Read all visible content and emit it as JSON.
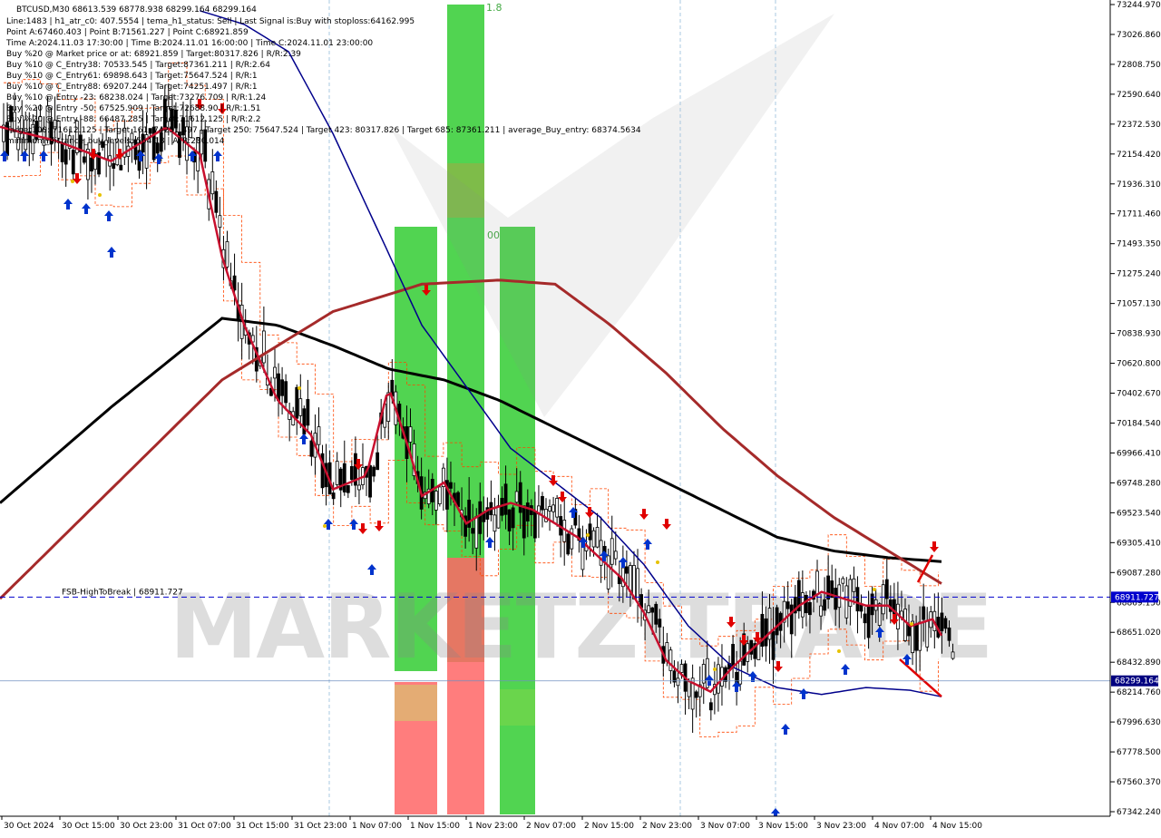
{
  "chart_data": {
    "type": "candlestick",
    "symbol_line": "BTCUSD,M30  68613.539 68778.938 68299.164 68299.164",
    "info_lines": [
      "Line:1483  |  h1_atr_c0: 407.5554  |  tema_h1_status: Sell  |  Last Signal is:Buy with stoploss:64162.995",
      "Point A:67460.403  |  Point B:71561.227  |  Point C:68921.859",
      "Time A:2024.11.03 17:30:00  |  Time B:2024.11.01 16:00:00  |  Time C:2024.11.01 23:00:00",
      "Buy %20 @ Market price or at: 68921.859  |  Target:80317.826  |  R/R:2.39",
      "Buy %10 @ C_Entry38: 70533.545  |  Target:87361.211  |  R/R:2.64",
      "Buy %10 @ C_Entry61: 69898.643  |  Target:75647.524  |  R/R:1",
      "Buy %10 @ C_Entry88: 69207.244  |  Target:74251.497  |  R/R:1",
      "Buy %10 @ Entry -23: 68238.024  |  Target:73276.709  |  R/R:1.24",
      "Buy %20 @ Entry -50: 67525.909  |  Target:72688.90  |  R/R:1.51",
      "Buy %20 @ Entry -88: 66487.285  |  Target:71612.125  |  R/R:2.2",
      "Target100: 71612.125  |  Target 161: 74251.497  |  Target 250: 75647.524  |  Target 423: 80317.826  |  Target 685: 87361.211  |  average_Buy_entry: 68374.5634",
      "minimum_distance_buy_levels: 564.18  |  ATR:280.014"
    ],
    "y_ticks": [
      "73244.970",
      "73026.860",
      "72808.750",
      "72590.640",
      "72372.530",
      "72154.420",
      "71936.310",
      "71711.460",
      "71493.350",
      "71275.240",
      "71057.130",
      "70838.930",
      "70620.800",
      "70402.670",
      "70184.540",
      "69966.410",
      "69748.280",
      "69523.540",
      "69305.410",
      "69087.280",
      "68869.150",
      "68651.020",
      "68432.890",
      "68214.760",
      "67996.630",
      "67778.500",
      "67560.370",
      "67342.240"
    ],
    "x_ticks": [
      "30 Oct 2024",
      "30 Oct 15:00",
      "30 Oct 23:00",
      "31 Oct 07:00",
      "31 Oct 15:00",
      "31 Oct 23:00",
      "1 Nov 07:00",
      "1 Nov 15:00",
      "1 Nov 23:00",
      "2 Nov 07:00",
      "2 Nov 15:00",
      "2 Nov 23:00",
      "3 Nov 07:00",
      "3 Nov 15:00",
      "3 Nov 23:00",
      "4 Nov 07:00",
      "4 Nov 15:00"
    ],
    "ylim": [
      67342.24,
      73244.97
    ],
    "fsb_line": {
      "label": "FSB-HighToBreak  |  68911.727",
      "value": 68911.727,
      "tag": "68911.727"
    },
    "current_price": {
      "value": 68299.164,
      "tag": "68299.164"
    },
    "fib_label_top": "1.8",
    "fib_label_mid": "00",
    "watermark": "MARKETZITRADE",
    "colors": {
      "bull_candle": "#000000",
      "bear_candle": "#000000",
      "ma_black": "#000000",
      "ma_brown": "#a52a2a",
      "ma_navy": "#00008b",
      "tema_red": "#c8102e",
      "channel_orange": "#ff4500",
      "fsb_blue": "#0000cd",
      "green_zone": "#33cc33",
      "red_zone": "#ff6666",
      "buy_arrow": "#0033cc",
      "sell_arrow": "#e00000",
      "price_tag_bg": "#0000cd",
      "current_tag_bg": "#000080"
    },
    "series": [
      {
        "name": "ma_black",
        "x_pct": [
          0,
          0.1,
          0.2,
          0.25,
          0.3,
          0.35,
          0.4,
          0.45,
          0.5,
          0.55,
          0.6,
          0.65,
          0.7,
          0.75,
          0.8,
          0.85
        ],
        "y": [
          69600,
          70300,
          70950,
          70900,
          70750,
          70580,
          70500,
          70350,
          70150,
          69950,
          69750,
          69550,
          69350,
          69250,
          69200,
          69170
        ]
      },
      {
        "name": "ma_brown",
        "x_pct": [
          0,
          0.1,
          0.2,
          0.3,
          0.38,
          0.45,
          0.5,
          0.55,
          0.6,
          0.65,
          0.7,
          0.75,
          0.8,
          0.85
        ],
        "y": [
          68900,
          69700,
          70500,
          71000,
          71200,
          71230,
          71200,
          70900,
          70550,
          70150,
          69800,
          69500,
          69250,
          69000
        ],
        "label": ""
      },
      {
        "name": "ma_navy",
        "x_pct": [
          0.18,
          0.22,
          0.26,
          0.3,
          0.34,
          0.38,
          0.42,
          0.46,
          0.5,
          0.54,
          0.58,
          0.62,
          0.66,
          0.7,
          0.74,
          0.78,
          0.82,
          0.85
        ],
        "y": [
          73200,
          73100,
          72900,
          72300,
          71600,
          70900,
          70450,
          70000,
          69750,
          69500,
          69150,
          68700,
          68400,
          68250,
          68200,
          68250,
          68230,
          68180
        ]
      },
      {
        "name": "tema",
        "x_pct": [
          0,
          0.05,
          0.1,
          0.15,
          0.18,
          0.2,
          0.22,
          0.25,
          0.28,
          0.3,
          0.33,
          0.35,
          0.37,
          0.38,
          0.4,
          0.42,
          0.44,
          0.46,
          0.48,
          0.5,
          0.52,
          0.54,
          0.56,
          0.58,
          0.6,
          0.62,
          0.64,
          0.66,
          0.68,
          0.7,
          0.72,
          0.74,
          0.76,
          0.78,
          0.8,
          0.82,
          0.84,
          0.85
        ],
        "y": [
          72350,
          72250,
          72100,
          72350,
          72150,
          71400,
          70900,
          70350,
          70100,
          69700,
          69800,
          70450,
          69950,
          69650,
          69750,
          69450,
          69550,
          69600,
          69550,
          69450,
          69350,
          69200,
          69050,
          68800,
          68450,
          68300,
          68220,
          68400,
          68550,
          68700,
          68850,
          68950,
          68900,
          68850,
          68850,
          68700,
          68750,
          68600
        ]
      }
    ],
    "candles_seed": 20241030
  }
}
